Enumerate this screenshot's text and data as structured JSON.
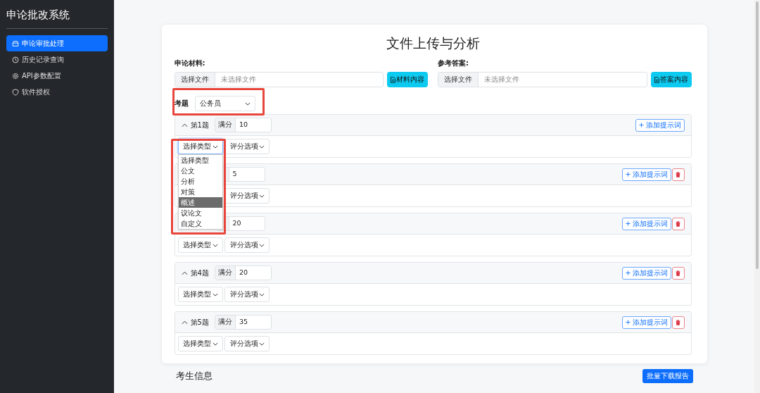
{
  "sidebar": {
    "title": "申论批改系统",
    "items": [
      {
        "label": "申论审批处理",
        "kind": "inbox",
        "selected": true
      },
      {
        "label": "历史记录查询",
        "kind": "clock",
        "selected": false
      },
      {
        "label": "API参数配置",
        "kind": "gear",
        "selected": false
      },
      {
        "label": "软件授权",
        "kind": "shield",
        "selected": false
      }
    ]
  },
  "page_title": "文件上传与分析",
  "uploads": [
    {
      "label": "申论材料:",
      "choose": "选择文件",
      "status": "未选择文件",
      "button": "材料内容"
    },
    {
      "label": "参考答案:",
      "choose": "选择文件",
      "status": "未选择文件",
      "button": "答案内容"
    }
  ],
  "exam": {
    "label": "考题",
    "value": "公务员"
  },
  "questions": [
    {
      "title": "第1题",
      "max_label": "满分",
      "score": "10",
      "add_button": "添加提示词",
      "deletable": false,
      "type_select": "选择类型",
      "type_focused": true,
      "scoring_select": "评分选项"
    },
    {
      "score": "5",
      "add_button": "添加提示词",
      "deletable": true,
      "scoring_select": "评分选项"
    },
    {
      "score": "20",
      "add_button": "添加提示词",
      "deletable": true,
      "type_select": "选择类型",
      "type_focused": false,
      "scoring_select": "评分选项"
    },
    {
      "title": "第4题",
      "max_label": "满分",
      "score": "20",
      "add_button": "添加提示词",
      "deletable": true,
      "type_select": "选择类型",
      "type_focused": false,
      "scoring_select": "评分选项"
    },
    {
      "title": "第5题",
      "max_label": "满分",
      "score": "35",
      "add_button": "添加提示词",
      "deletable": true,
      "type_select": "选择类型",
      "type_focused": false,
      "scoring_select": "评分选项"
    }
  ],
  "type_dropdown": [
    {
      "label": "选择类型",
      "selected": false
    },
    {
      "label": "公文",
      "selected": false
    },
    {
      "label": "分析",
      "selected": false
    },
    {
      "label": "对策",
      "selected": false
    },
    {
      "label": "概述",
      "selected": true
    },
    {
      "label": "议论文",
      "selected": false
    },
    {
      "label": "自定义",
      "selected": false
    }
  ],
  "candidate_section": {
    "title": "考生信息",
    "button": "批量下载报告"
  }
}
